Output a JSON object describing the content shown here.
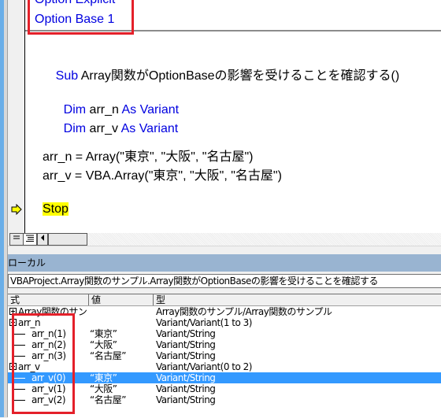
{
  "editor": {
    "lines": {
      "option_explicit": "Option Explicit",
      "option_base": "Option Base 1",
      "sub_kw": "Sub",
      "sub_name": " Array関数がOptionBaseの影響を受けることを確認する()",
      "dim1_kw": "Dim",
      "dim1_var": " arr_n ",
      "dim1_as": "As Variant",
      "dim2_kw": "Dim",
      "dim2_var": " arr_v ",
      "dim2_as": "As Variant",
      "assign1": "arr_n = Array(\"東京\", \"大阪\", \"名古屋\")",
      "assign2": "arr_v = VBA.Array(\"東京\", \"大阪\", \"名古屋\")",
      "stop": "Stop"
    },
    "current_line_icon": "arrow-right-icon",
    "highlight_color": "#ffff00",
    "keyword_color": "#0000e0"
  },
  "scrollbar": {
    "procedure_view_icon": "procedure-view-icon",
    "module_view_icon": "full-module-view-icon",
    "scroll_left_icon": "scroll-left-icon"
  },
  "locals": {
    "title": "ローカル",
    "context": "VBAProject.Array関数のサンプル.Array関数がOptionBaseの影響を受けることを確認する",
    "columns": [
      "式",
      "値",
      "型"
    ],
    "rows": [
      {
        "expr": "Array関数のサン",
        "value": "",
        "type": "Array関数のサンプル/Array関数のサンプル",
        "level": 0,
        "expander": true
      },
      {
        "expr": "arr_n",
        "value": "",
        "type": "Variant/Variant(1 to 3)",
        "level": 0,
        "expander": true
      },
      {
        "expr": "arr_n(1)",
        "value": "“東京”",
        "type": "Variant/String",
        "level": 1
      },
      {
        "expr": "arr_n(2)",
        "value": "“大阪”",
        "type": "Variant/String",
        "level": 1
      },
      {
        "expr": "arr_n(3)",
        "value": "“名古屋”",
        "type": "Variant/String",
        "level": 1
      },
      {
        "expr": "arr_v",
        "value": "",
        "type": "Variant/Variant(0 to 2)",
        "level": 0,
        "expander": true
      },
      {
        "expr": "arr_v(0)",
        "value": "“東京”",
        "type": "Variant/String",
        "level": 1,
        "selected": true
      },
      {
        "expr": "arr_v(1)",
        "value": "“大阪”",
        "type": "Variant/String",
        "level": 1
      },
      {
        "expr": "arr_v(2)",
        "value": "“名古屋”",
        "type": "Variant/String",
        "level": 1
      }
    ],
    "selection_color": "#3399ff",
    "title_bar_color": "#99b4d1"
  },
  "annotations": {
    "box_color": "#e4202a"
  }
}
